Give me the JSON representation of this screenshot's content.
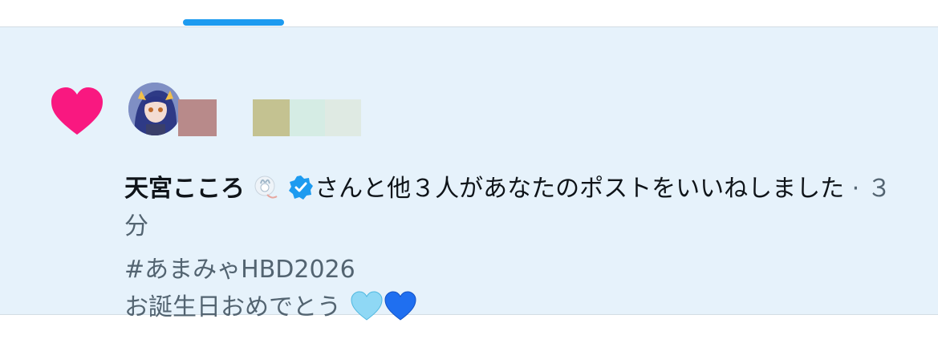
{
  "notification": {
    "liker_name": "天宮こころ",
    "action_text": "さんと他３人があなたのポストをいいねしました",
    "separator": "·",
    "time_ago": "３分",
    "post_line1": "#あまみゃHBD2026",
    "post_line2": "お誕生日おめでとう",
    "emoji": [
      "light-blue-heart",
      "blue-heart"
    ],
    "icons": [
      "heart-icon",
      "avatar",
      "bunny-badge-icon",
      "verified-badge-icon"
    ]
  },
  "colors": {
    "accent": "#1d9bf0",
    "heart": "#f91880",
    "background_highlight": "#e6f2fb",
    "secondary_text": "#536471"
  }
}
